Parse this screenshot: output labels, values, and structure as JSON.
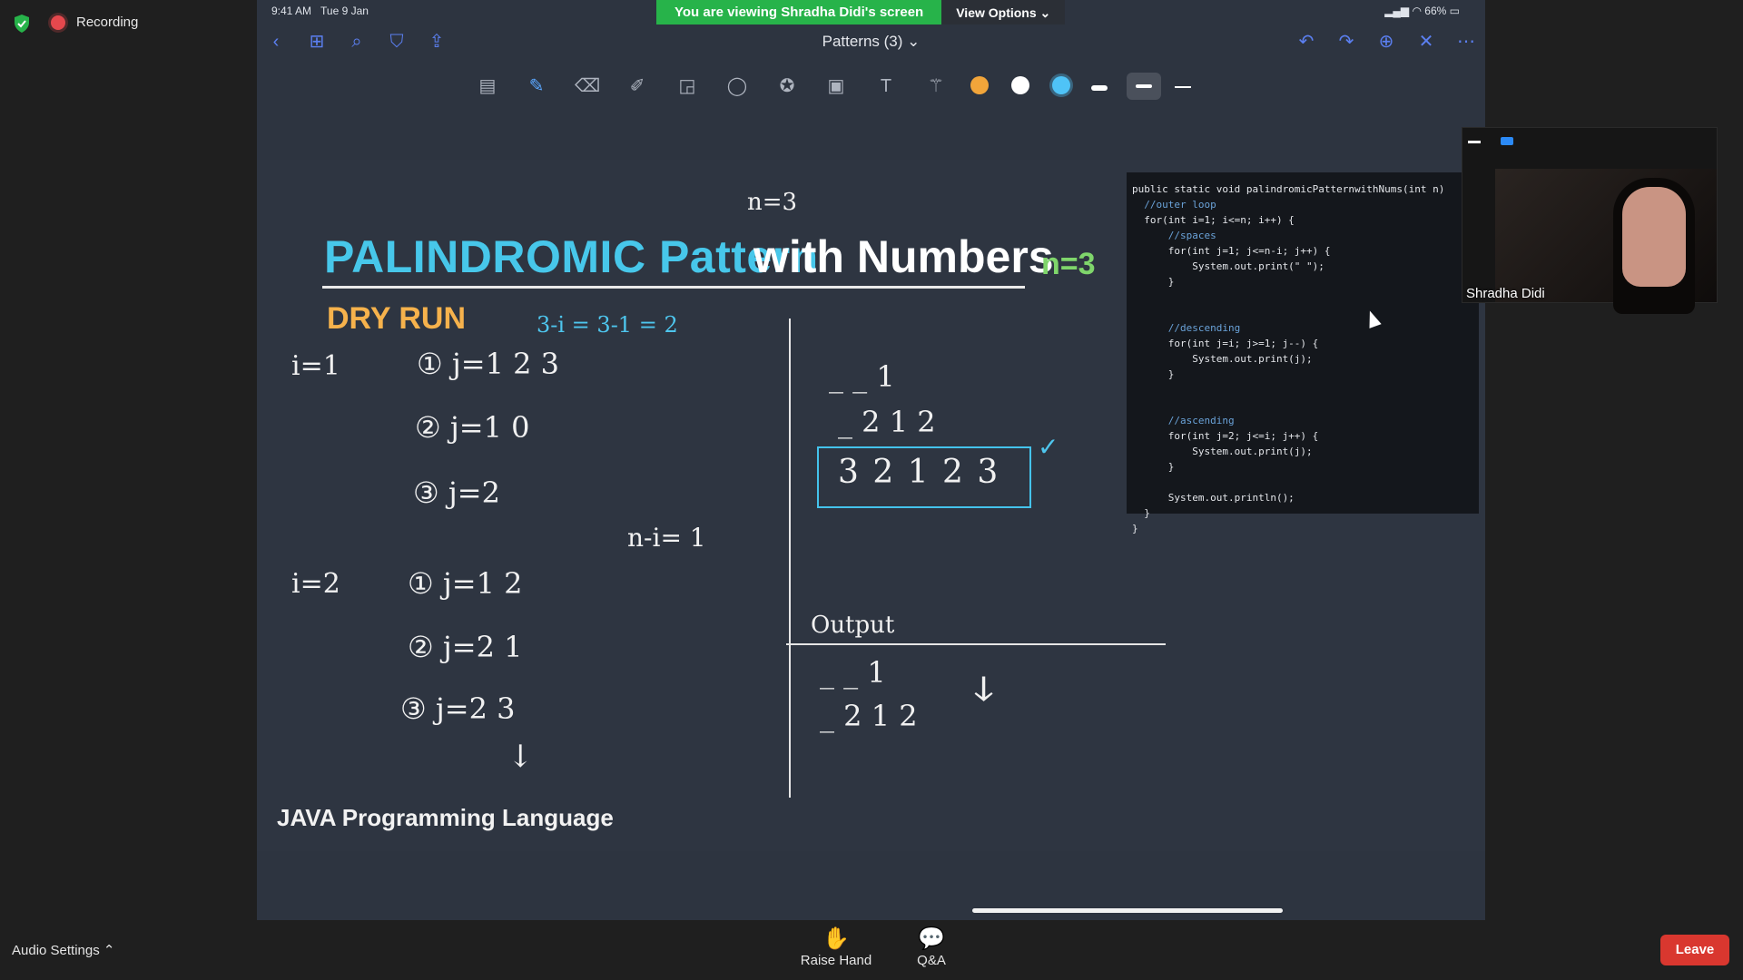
{
  "zoom": {
    "recording_label": "Recording",
    "banner_text": "You are viewing Shradha Didi's screen",
    "view_options_label": "View Options",
    "audio_settings_label": "Audio Settings",
    "raise_hand_label": "Raise Hand",
    "qa_label": "Q&A",
    "leave_label": "Leave",
    "participant_name": "Shradha Didi"
  },
  "ipad": {
    "time": "9:41 AM",
    "date": "Tue 9 Jan",
    "battery": "66%",
    "document_title": "Patterns (3)",
    "colors": {
      "orange": "#f2a53a",
      "white": "#ffffff",
      "blue": "#4fc3f7"
    }
  },
  "slide": {
    "title_colored": "PALINDROMIC Pattern",
    "title_white": "with Numbers",
    "n_label": "n=3",
    "subtitle": "DRY RUN",
    "footer": "JAVA Programming Language"
  },
  "handwriting": {
    "top_n": "n=3",
    "formula": "3-i = 3-1 = 2",
    "i1": "i=1",
    "i1_step1": "① j=1 2 3",
    "i1_step2": "② j=1 0",
    "i1_step3": "③ j=2",
    "n_minus_i": "n-i= 1",
    "i2": "i=2",
    "i2_step1": "① j=1 2",
    "i2_step2": "② j=2 1",
    "i2_step3": "③ j=2 3",
    "row1": "_ _ 1",
    "row2": "_ 2 1 2",
    "row3": "3 2 1 2 3",
    "output_label": "Output",
    "out_row1": "_ _ 1",
    "out_row2": "_ 2 1 2"
  },
  "code": {
    "lines": [
      "public static void palindromicPatternwithNums(int n)",
      "  //outer loop",
      "  for(int i=1; i<=n; i++) {",
      "      //spaces",
      "      for(int j=1; j<=n-i; j++) {",
      "          System.out.print(\" \");",
      "      }",
      "",
      "",
      "      //descending",
      "      for(int j=i; j>=1; j--) {",
      "          System.out.print(j);",
      "      }",
      "",
      "",
      "      //ascending",
      "      for(int j=2; j<=i; j++) {",
      "          System.out.print(j);",
      "      }",
      "",
      "      System.out.println();",
      "  }",
      "}"
    ]
  }
}
